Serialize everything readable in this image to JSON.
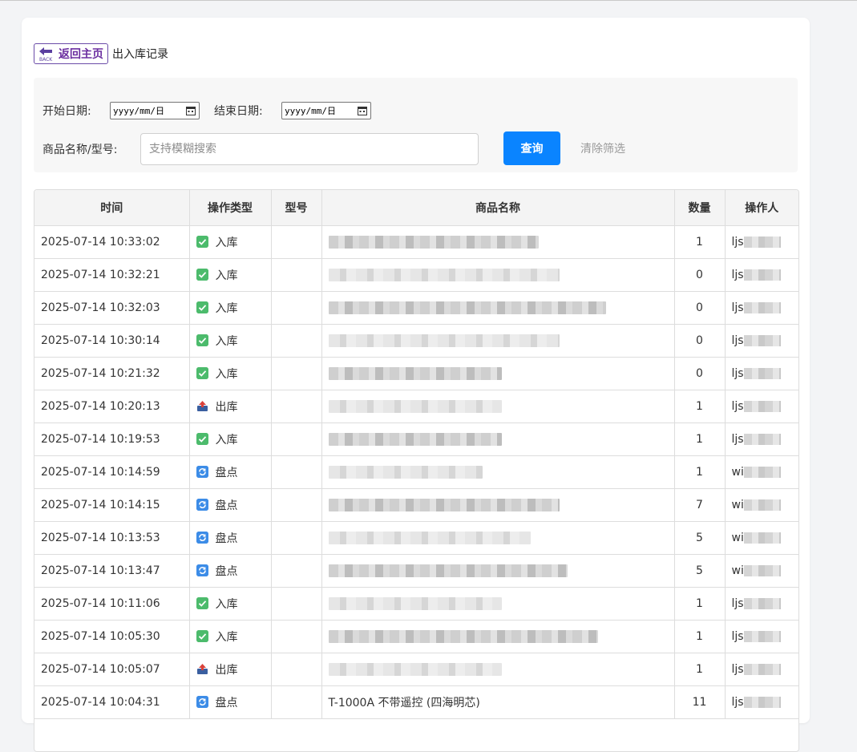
{
  "header": {
    "back_label": "返回主页",
    "page_title": "出入库记录"
  },
  "filters": {
    "start_label": "开始日期:",
    "start_value": "yyyy/mm/日",
    "end_label": "结束日期:",
    "end_value": "yyyy/mm/日",
    "name_label": "商品名称/型号:",
    "search_placeholder": "支持模糊搜索",
    "query_label": "查询",
    "clear_label": "清除筛选"
  },
  "table": {
    "columns": [
      "时间",
      "操作类型",
      "型号",
      "商品名称",
      "数量",
      "操作人"
    ],
    "rows": [
      {
        "time": "2025-07-14 10:33:02",
        "type": "入库",
        "kind": "in",
        "model": "",
        "name": "",
        "name_w": 262,
        "qty": "1",
        "op": "ljs"
      },
      {
        "time": "2025-07-14 10:32:21",
        "type": "入库",
        "kind": "in",
        "model": "",
        "name": "",
        "name_w": 288,
        "qty": "0",
        "op": "ljs"
      },
      {
        "time": "2025-07-14 10:32:03",
        "type": "入库",
        "kind": "in",
        "model": "",
        "name": "",
        "name_w": 346,
        "qty": "0",
        "op": "ljs"
      },
      {
        "time": "2025-07-14 10:30:14",
        "type": "入库",
        "kind": "in",
        "model": "",
        "name": "",
        "name_w": 288,
        "qty": "0",
        "op": "ljs"
      },
      {
        "time": "2025-07-14 10:21:32",
        "type": "入库",
        "kind": "in",
        "model": "",
        "name": "",
        "name_w": 216,
        "qty": "0",
        "op": "ljs"
      },
      {
        "time": "2025-07-14 10:20:13",
        "type": "出库",
        "kind": "out",
        "model": "",
        "name": "",
        "name_w": 216,
        "qty": "1",
        "op": "ljs"
      },
      {
        "time": "2025-07-14 10:19:53",
        "type": "入库",
        "kind": "in",
        "model": "",
        "name": "",
        "name_w": 216,
        "qty": "1",
        "op": "ljs"
      },
      {
        "time": "2025-07-14 10:14:59",
        "type": "盘点",
        "kind": "inv",
        "model": "",
        "name": "",
        "name_w": 192,
        "qty": "1",
        "op": "wi"
      },
      {
        "time": "2025-07-14 10:14:15",
        "type": "盘点",
        "kind": "inv",
        "model": "",
        "name": "",
        "name_w": 288,
        "qty": "7",
        "op": "wi"
      },
      {
        "time": "2025-07-14 10:13:53",
        "type": "盘点",
        "kind": "inv",
        "model": "",
        "name": "",
        "name_w": 252,
        "qty": "5",
        "op": "wi"
      },
      {
        "time": "2025-07-14 10:13:47",
        "type": "盘点",
        "kind": "inv",
        "model": "",
        "name": "",
        "name_w": 298,
        "qty": "5",
        "op": "wi"
      },
      {
        "time": "2025-07-14 10:11:06",
        "type": "入库",
        "kind": "in",
        "model": "",
        "name": "",
        "name_w": 216,
        "qty": "1",
        "op": "ljs"
      },
      {
        "time": "2025-07-14 10:05:30",
        "type": "入库",
        "kind": "in",
        "model": "",
        "name": "",
        "name_w": 336,
        "qty": "1",
        "op": "ljs"
      },
      {
        "time": "2025-07-14 10:05:07",
        "type": "出库",
        "kind": "out",
        "model": "",
        "name": "",
        "name_w": 216,
        "qty": "1",
        "op": "ljs"
      },
      {
        "time": "2025-07-14 10:04:31",
        "type": "盘点",
        "kind": "inv",
        "model": "",
        "name": "T-1000A 不带遥控 (四海明芯)",
        "name_w": 0,
        "qty": "11",
        "op": "ljs"
      }
    ]
  },
  "colors": {
    "accent": "#0a84ff",
    "back_border": "#6b4ca8",
    "in_icon": "#4cbb6c",
    "inv_icon": "#3c8ce7",
    "out_icon": "#d9413a"
  }
}
